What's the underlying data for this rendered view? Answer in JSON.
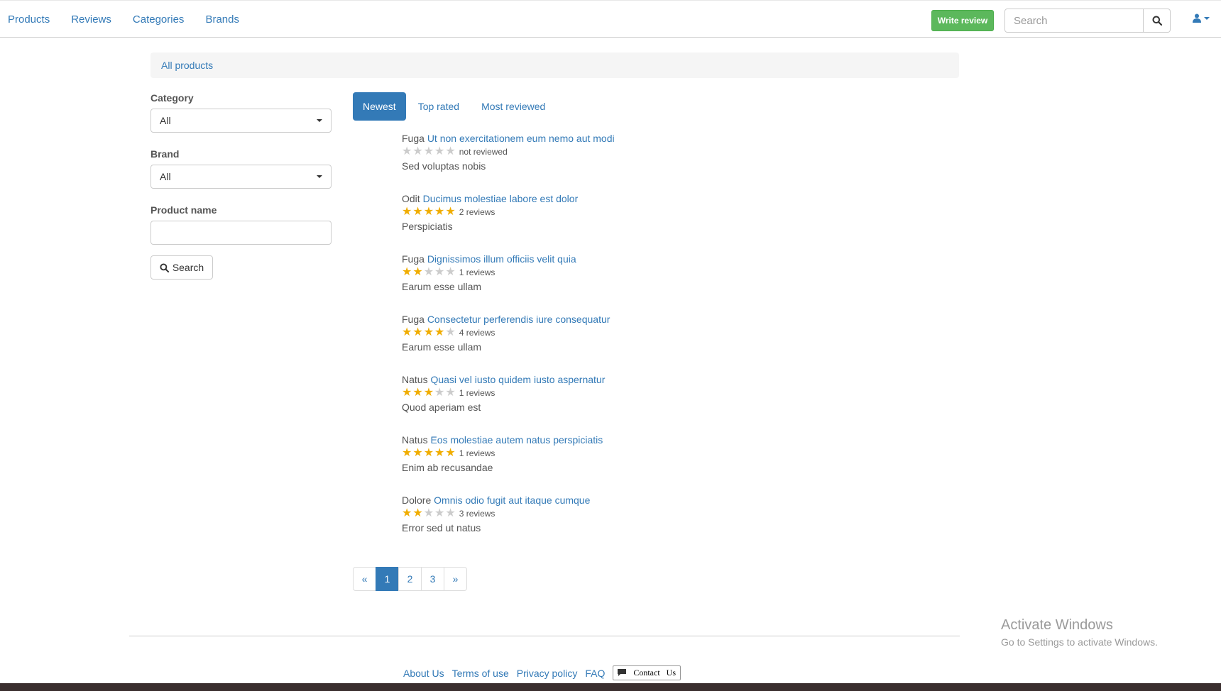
{
  "nav": {
    "items": [
      "Products",
      "Reviews",
      "Categories",
      "Brands"
    ],
    "write_review": "Write review",
    "search_placeholder": "Search"
  },
  "breadcrumb": {
    "label": "All products"
  },
  "filters": {
    "category_label": "Category",
    "category_value": "All",
    "brand_label": "Brand",
    "brand_value": "All",
    "product_name_label": "Product name",
    "product_name_value": "",
    "search_button": "Search"
  },
  "tabs": [
    {
      "label": "Newest",
      "active": true
    },
    {
      "label": "Top rated",
      "active": false
    },
    {
      "label": "Most reviewed",
      "active": false
    }
  ],
  "products": [
    {
      "brand": "Fuga",
      "name": "Ut non exercitationem eum nemo aut modi",
      "rating": 0,
      "reviews": "not reviewed",
      "category": "Sed voluptas nobis"
    },
    {
      "brand": "Odit",
      "name": "Ducimus molestiae labore est dolor",
      "rating": 5,
      "reviews": "2 reviews",
      "category": "Perspiciatis"
    },
    {
      "brand": "Fuga",
      "name": "Dignissimos illum officiis velit quia",
      "rating": 2,
      "reviews": "1 reviews",
      "category": "Earum esse ullam"
    },
    {
      "brand": "Fuga",
      "name": "Consectetur perferendis iure consequatur",
      "rating": 4,
      "reviews": "4 reviews",
      "category": "Earum esse ullam"
    },
    {
      "brand": "Natus",
      "name": "Quasi vel iusto quidem iusto aspernatur",
      "rating": 3,
      "reviews": "1 reviews",
      "category": "Quod aperiam est"
    },
    {
      "brand": "Natus",
      "name": "Eos molestiae autem natus perspiciatis",
      "rating": 5,
      "reviews": "1 reviews",
      "category": "Enim ab recusandae"
    },
    {
      "brand": "Dolore",
      "name": "Omnis odio fugit aut itaque cumque",
      "rating": 2,
      "reviews": "3 reviews",
      "category": "Error sed ut natus"
    }
  ],
  "pagination": {
    "prev": "«",
    "pages": [
      "1",
      "2",
      "3"
    ],
    "current": "1",
    "next": "»"
  },
  "watermark": {
    "title": "Activate Windows",
    "subtitle": "Go to Settings to activate Windows."
  },
  "footer": {
    "links": [
      "About Us",
      "Terms of use",
      "Privacy policy",
      "FAQ"
    ],
    "contact": "Contact   Us"
  },
  "colors": {
    "primary": "#337ab7",
    "success": "#5cb85c",
    "star": "#f0ad00"
  }
}
